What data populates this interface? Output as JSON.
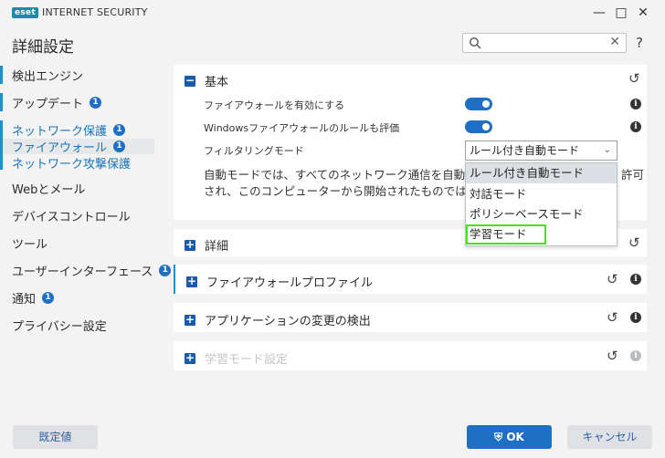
{
  "window": {
    "logo": "eset",
    "product": "INTERNET SECURITY",
    "minimize_icon": "minimize-icon",
    "maximize_icon": "maximize-icon",
    "close_icon": "close-icon"
  },
  "page_title": "詳細設定",
  "search": {
    "placeholder": "",
    "value": ""
  },
  "help": "?",
  "sidebar": {
    "items": [
      {
        "label": "検出エンジン",
        "badge": ""
      },
      {
        "label": "アップデート",
        "badge": "1"
      },
      {
        "label": "ネットワーク保護",
        "badge": "1"
      },
      {
        "label": "ファイアウォール",
        "badge": "1"
      },
      {
        "label": "ネットワーク攻撃保護",
        "badge": ""
      },
      {
        "label": "Webとメール",
        "badge": ""
      },
      {
        "label": "デバイスコントロール",
        "badge": ""
      },
      {
        "label": "ツール",
        "badge": ""
      },
      {
        "label": "ユーザーインターフェース",
        "badge": "1"
      },
      {
        "label": "通知",
        "badge": "1"
      },
      {
        "label": "プライバシー設定",
        "badge": ""
      }
    ]
  },
  "sections": {
    "basic": {
      "title": "基本",
      "rows": {
        "firewall_enable": {
          "label": "ファイアウォールを有効にする",
          "on": true
        },
        "windows_rules": {
          "label": "Windowsファイアウォールのルールも評価",
          "on": true
        },
        "filter_mode": {
          "label": "フィルタリングモード",
          "selected": "ルール付き自動モード"
        }
      },
      "description_line1": "自動モードでは、すべてのネットワーク通信を自動的に評価",
      "description_tail1": "許可",
      "description_line2": "され、このコンピューターから開始されたものではない内向き",
      "dropdown_options": [
        "ルール付き自動モード",
        "対話モード",
        "ポリシーベースモード",
        "学習モード"
      ]
    },
    "details": {
      "title": "詳細"
    },
    "profiles": {
      "title": "ファイアウォールプロファイル"
    },
    "app_change": {
      "title": "アプリケーションの変更の検出"
    },
    "learning": {
      "title": "学習モード設定"
    }
  },
  "footer": {
    "default_label": "既定値",
    "ok_label": "OK",
    "cancel_label": "キャンセル"
  },
  "colors": {
    "accent": "#1f6fc4",
    "nav_link": "#1a74b8",
    "focus_outline": "#45e01e"
  }
}
